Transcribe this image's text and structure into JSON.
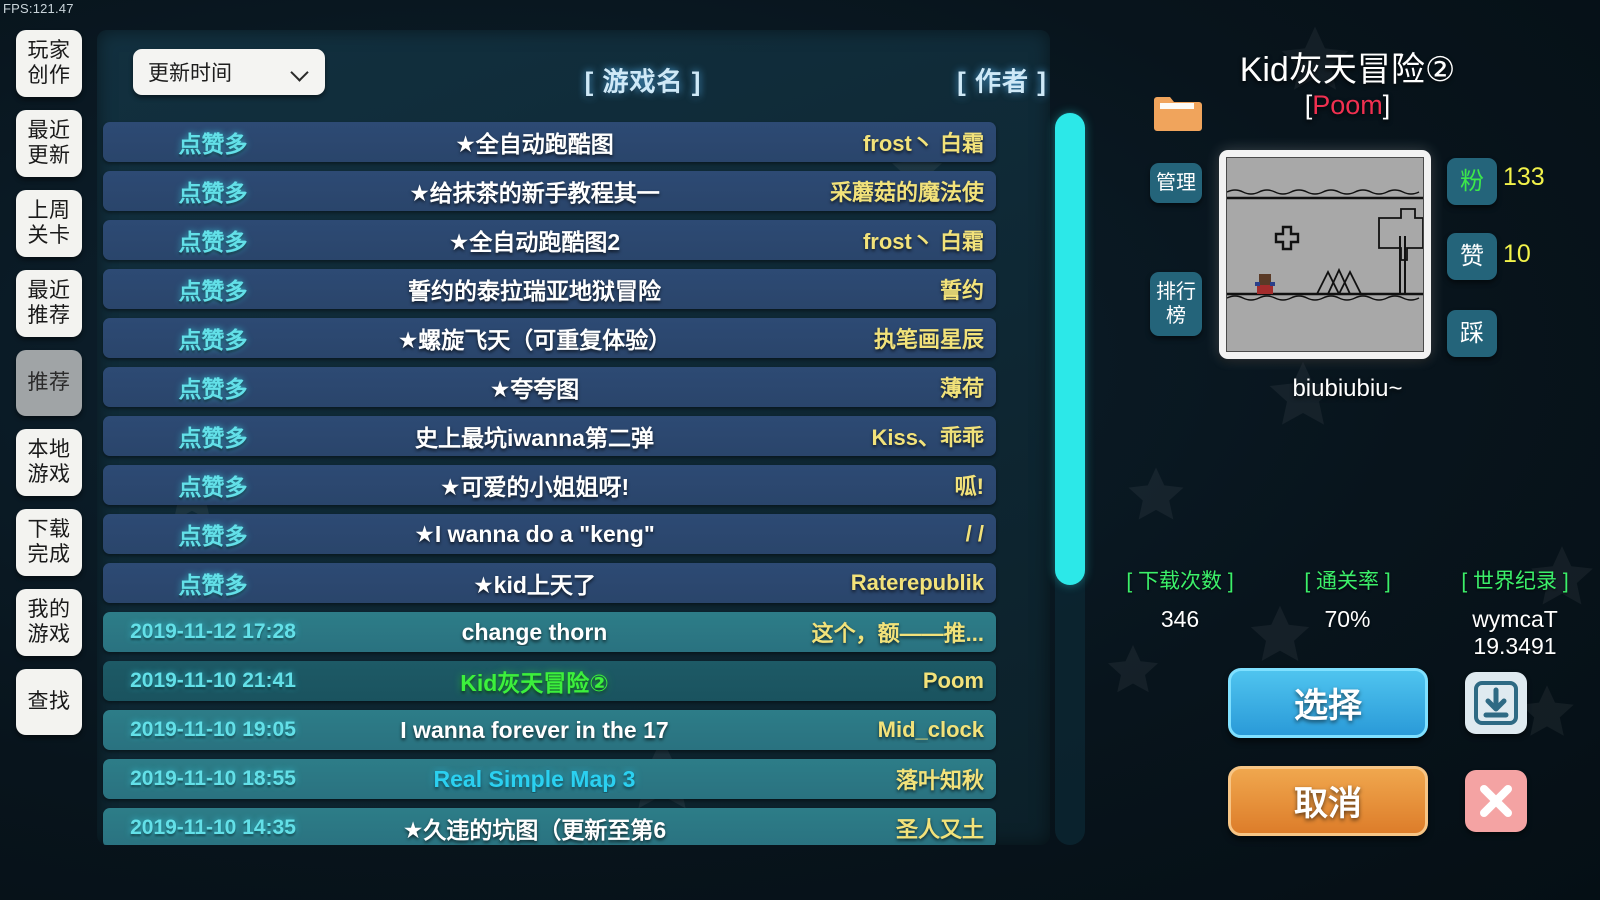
{
  "hud": {
    "fps": "FPS:121.47"
  },
  "sidebar": {
    "items": [
      {
        "label": "玩家创作",
        "lines": [
          "玩家",
          "创作"
        ],
        "active": false
      },
      {
        "label": "最近更新",
        "lines": [
          "最近",
          "更新"
        ],
        "active": false
      },
      {
        "label": "上周关卡",
        "lines": [
          "上周",
          "关卡"
        ],
        "active": false
      },
      {
        "label": "最近推荐",
        "lines": [
          "最近",
          "推荐"
        ],
        "active": false
      },
      {
        "label": "推荐",
        "lines": [
          "推荐"
        ],
        "active": true
      },
      {
        "label": "本地游戏",
        "lines": [
          "本地",
          "游戏"
        ],
        "active": false
      },
      {
        "label": "下载完成",
        "lines": [
          "下载",
          "完成"
        ],
        "active": false
      },
      {
        "label": "我的游戏",
        "lines": [
          "我的",
          "游戏"
        ],
        "active": false
      },
      {
        "label": "查找",
        "lines": [
          "查找"
        ],
        "active": false
      }
    ]
  },
  "list": {
    "sort_label": "更新时间",
    "col_name": "[ 游戏名 ]",
    "col_author": "[ 作者 ]",
    "rows": [
      {
        "meta": "点赞多",
        "name": "★全自动跑酷图",
        "author": "frost丶 白霜",
        "style": "blue"
      },
      {
        "meta": "点赞多",
        "name": "★给抹茶的新手教程其一",
        "author": "采蘑菇的魔法使",
        "style": "blue"
      },
      {
        "meta": "点赞多",
        "name": "★全自动跑酷图2",
        "author": "frost丶 白霜",
        "style": "blue"
      },
      {
        "meta": "点赞多",
        "name": "誓约的泰拉瑞亚地狱冒险",
        "author": "誓约",
        "style": "blue"
      },
      {
        "meta": "点赞多",
        "name": "★螺旋飞天（可重复体验）",
        "author": "执笔画星辰",
        "style": "blue"
      },
      {
        "meta": "点赞多",
        "name": "★夸夸图",
        "author": "薄荷",
        "style": "blue"
      },
      {
        "meta": "点赞多",
        "name": "史上最坑iwanna第二弹",
        "author": "Kiss、乖乖",
        "style": "blue"
      },
      {
        "meta": "点赞多",
        "name": "★可爱的小姐姐呀!",
        "author": "呱!",
        "style": "blue"
      },
      {
        "meta": "点赞多",
        "name": "★I wanna do a \"keng\"",
        "author": "/ /",
        "style": "blue"
      },
      {
        "meta": "点赞多",
        "name": "★kid上天了",
        "author": "Raterepublik",
        "style": "blue"
      },
      {
        "meta": "2019-11-12 17:28",
        "name": "change thorn",
        "author": "这个，额——推...",
        "style": "teal"
      },
      {
        "meta": "2019-11-10 21:41",
        "name": "Kid灰天冒险②",
        "author": "Poom",
        "style": "teal-sel",
        "name_color": "green"
      },
      {
        "meta": "2019-11-10 19:05",
        "name": "I wanna forever in the 17",
        "author": "Mid_clock",
        "style": "teal"
      },
      {
        "meta": "2019-11-10 18:55",
        "name": "Real Simple Map 3",
        "author": "落叶知秋",
        "style": "teal",
        "name_color": "cyan"
      },
      {
        "meta": "2019-11-10 14:35",
        "name": "★久违的坑图（更新至第6",
        "author": "圣人又土",
        "style": "teal"
      }
    ]
  },
  "detail": {
    "title": "Kid灰天冒险②",
    "author_prefix": "[",
    "author_name": "Poom",
    "author_suffix": "]",
    "subtitle": "biubiubiu~",
    "manage_label": "管理",
    "rank_label": "排行榜",
    "fans_label": "粉",
    "fans_count": "133",
    "like_label": "赞",
    "like_count": "10",
    "dislike_label": "踩",
    "metrics": [
      {
        "label": "[ 下载次数 ]",
        "value": "346"
      },
      {
        "label": "[ 通关率 ]",
        "value": "70%"
      },
      {
        "label": "[ 世界纪录 ]",
        "value": "wymcaT",
        "value2": "19.3491"
      }
    ],
    "select_label": "选择",
    "cancel_label": "取消"
  },
  "colors": {
    "accent_cyan": "#2ce8e8",
    "row_blue": "#2d4a74",
    "row_teal": "#2d7d88",
    "row_teal_selected": "#1d5a66",
    "author_yellow": "#f2e27a",
    "metric_green": "#3cf06a",
    "select_blue": "#4fc4ef",
    "cancel_orange": "#f0a74e",
    "author_red": "#f03050"
  }
}
